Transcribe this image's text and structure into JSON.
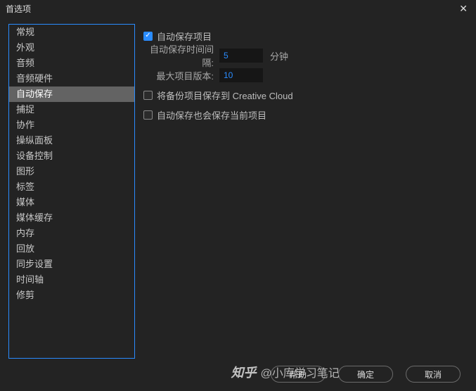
{
  "window": {
    "title": "首选项"
  },
  "sidebar": {
    "items": [
      {
        "label": "常规"
      },
      {
        "label": "外观"
      },
      {
        "label": "音频"
      },
      {
        "label": "音频硬件"
      },
      {
        "label": "自动保存",
        "selected": true
      },
      {
        "label": "捕捉"
      },
      {
        "label": "协作"
      },
      {
        "label": "操纵面板"
      },
      {
        "label": "设备控制"
      },
      {
        "label": "图形"
      },
      {
        "label": "标签"
      },
      {
        "label": "媒体"
      },
      {
        "label": "媒体缓存"
      },
      {
        "label": "内存"
      },
      {
        "label": "回放"
      },
      {
        "label": "同步设置"
      },
      {
        "label": "时间轴"
      },
      {
        "label": "修剪"
      }
    ]
  },
  "content": {
    "autosave_enable": {
      "label": "自动保存项目",
      "checked": true
    },
    "interval": {
      "label": "自动保存时间间隔:",
      "value": "5",
      "unit": "分钟"
    },
    "max_versions": {
      "label": "最大项目版本:",
      "value": "10"
    },
    "backup_cc": {
      "label": "将备份项目保存到 Creative Cloud",
      "checked": false
    },
    "save_current": {
      "label": "自动保存也会保存当前项目",
      "checked": false
    }
  },
  "footer": {
    "help": "帮助",
    "ok": "确定",
    "cancel": "取消"
  },
  "watermark": {
    "logo": "知乎",
    "text": "@小库学习笔记"
  }
}
